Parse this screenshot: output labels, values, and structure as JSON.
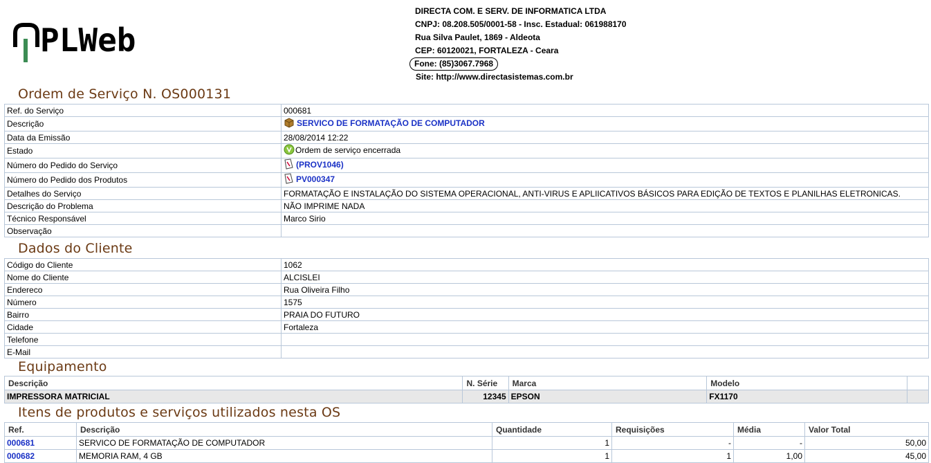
{
  "logo": {
    "text": "PLWeb"
  },
  "company": {
    "name": "DIRECTA COM. E SERV. DE INFORMATICA LTDA",
    "cnpj": "CNPJ: 08.208.505/0001-58 - Insc. Estadual: 061988170",
    "street": "Rua Silva Paulet, 1869 - Aldeota",
    "cep": "CEP: 60120021, FORTALEZA - Ceara",
    "phone": "Fone: (85)3067.7968",
    "site": "Site: http://www.directasistemas.com.br"
  },
  "order": {
    "title": "Ordem de Serviço N. OS000131",
    "rows": [
      {
        "label": "Ref. do Serviço",
        "value": "000681"
      },
      {
        "label": "Descrição",
        "value": "SERVICO DE FORMATAÇÃO DE COMPUTADOR",
        "icon": "box-icon"
      },
      {
        "label": "Data da Emissão",
        "value": "28/08/2014 12:22"
      },
      {
        "label": "Estado",
        "value": "Ordem de serviço encerrada",
        "icon": "check-icon"
      },
      {
        "label": "Número do Pedido do Serviço",
        "value": "(PROV1046)",
        "icon": "document-icon"
      },
      {
        "label": "Número do Pedido dos Produtos",
        "value": "PV000347",
        "icon": "document-icon"
      },
      {
        "label": "Detalhes do Serviço",
        "value": "FORMATAÇÃO E INSTALAÇÃO DO SISTEMA OPERACIONAL, ANTI-VIRUS E APLIICATIVOS BÁSICOS PARA EDIÇÃO DE TEXTOS E PLANILHAS ELETRONICAS."
      },
      {
        "label": "Descrição do Problema",
        "value": "NÃO IMPRIME NADA"
      },
      {
        "label": "Técnico Responsável",
        "value": "Marco Sirio"
      },
      {
        "label": "Observação",
        "value": ""
      }
    ]
  },
  "client": {
    "title": "Dados do Cliente",
    "rows": [
      {
        "label": "Código do Cliente",
        "value": "1062"
      },
      {
        "label": "Nome do Cliente",
        "value": "ALCISLEI"
      },
      {
        "label": "Endereco",
        "value": "Rua Oliveira Filho"
      },
      {
        "label": "Número",
        "value": "1575"
      },
      {
        "label": "Bairro",
        "value": "PRAIA DO FUTURO"
      },
      {
        "label": "Cidade",
        "value": "Fortaleza"
      },
      {
        "label": "Telefone",
        "value": ""
      },
      {
        "label": "E-Mail",
        "value": ""
      }
    ]
  },
  "equipment": {
    "title": "Equipamento",
    "headers": [
      "Descrição",
      "N. Série",
      "Marca",
      "Modelo"
    ],
    "row": [
      "IMPRESSORA MATRICIAL",
      "12345",
      "EPSON",
      "FX1170"
    ]
  },
  "items": {
    "title": "Itens de produtos e serviços utilizados nesta OS",
    "headers": [
      "Ref.",
      "Descrição",
      "Quantidade",
      "Requisições",
      "Média",
      "Valor Total"
    ],
    "rows": [
      [
        "000681",
        "SERVICO DE FORMATAÇÃO DE COMPUTADOR",
        "1",
        "-",
        "-",
        "50,00"
      ],
      [
        "000682",
        "MEMORIA RAM, 4 GB",
        "1",
        "1",
        "1,00",
        "45,00"
      ]
    ]
  }
}
